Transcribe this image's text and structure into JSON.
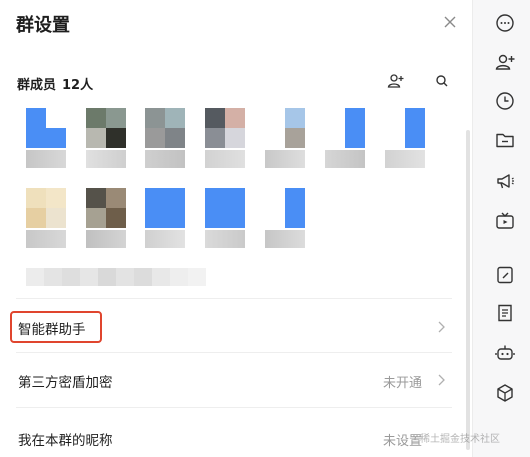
{
  "header": {
    "title": "群设置"
  },
  "members": {
    "title": "群成员",
    "count": "12人"
  },
  "rows": [
    {
      "label": "智能群助手",
      "value": ""
    },
    {
      "label": "第三方密盾加密",
      "value": "未开通"
    },
    {
      "label": "我在本群的昵称",
      "value": "未设置"
    }
  ],
  "watermark": "稀土掘金技术社区",
  "colors": {
    "highlight": "#e0452e",
    "accent": "#4a8ef5",
    "text": "#1f1f1f",
    "muted": "#9a9a9a"
  },
  "rail_icons": [
    "more-icon",
    "add-member-icon",
    "history-icon",
    "folder-icon",
    "announcement-icon",
    "live-icon",
    "notes-icon",
    "document-icon",
    "bot-icon",
    "apps-icon"
  ]
}
